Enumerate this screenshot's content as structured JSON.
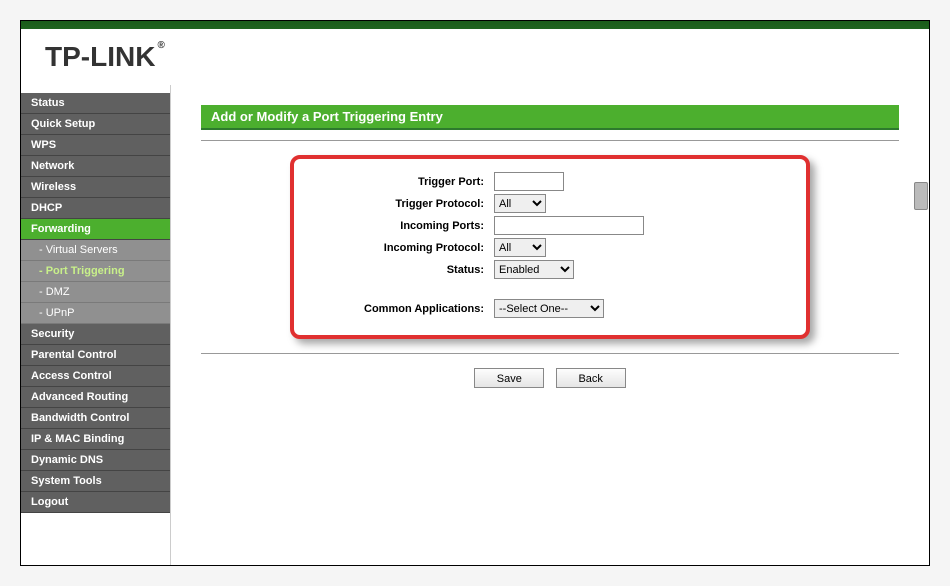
{
  "brand": "TP-LINK",
  "sidebar": {
    "items": [
      {
        "label": "Status",
        "active": false,
        "sub": false
      },
      {
        "label": "Quick Setup",
        "active": false,
        "sub": false
      },
      {
        "label": "WPS",
        "active": false,
        "sub": false
      },
      {
        "label": "Network",
        "active": false,
        "sub": false
      },
      {
        "label": "Wireless",
        "active": false,
        "sub": false
      },
      {
        "label": "DHCP",
        "active": false,
        "sub": false
      },
      {
        "label": "Forwarding",
        "active": true,
        "sub": false
      },
      {
        "label": "- Virtual Servers",
        "active": false,
        "sub": true
      },
      {
        "label": "- Port Triggering",
        "active": true,
        "sub": true
      },
      {
        "label": "- DMZ",
        "active": false,
        "sub": true
      },
      {
        "label": "- UPnP",
        "active": false,
        "sub": true
      },
      {
        "label": "Security",
        "active": false,
        "sub": false
      },
      {
        "label": "Parental Control",
        "active": false,
        "sub": false
      },
      {
        "label": "Access Control",
        "active": false,
        "sub": false
      },
      {
        "label": "Advanced Routing",
        "active": false,
        "sub": false
      },
      {
        "label": "Bandwidth Control",
        "active": false,
        "sub": false
      },
      {
        "label": "IP & MAC Binding",
        "active": false,
        "sub": false
      },
      {
        "label": "Dynamic DNS",
        "active": false,
        "sub": false
      },
      {
        "label": "System Tools",
        "active": false,
        "sub": false
      },
      {
        "label": "Logout",
        "active": false,
        "sub": false
      }
    ]
  },
  "page": {
    "title": "Add or Modify a Port Triggering Entry"
  },
  "form": {
    "trigger_port_label": "Trigger Port:",
    "trigger_port_value": "",
    "trigger_protocol_label": "Trigger Protocol:",
    "trigger_protocol_value": "All",
    "incoming_ports_label": "Incoming Ports:",
    "incoming_ports_value": "",
    "incoming_protocol_label": "Incoming Protocol:",
    "incoming_protocol_value": "All",
    "status_label": "Status:",
    "status_value": "Enabled",
    "common_app_label": "Common Applications:",
    "common_app_value": "--Select One--"
  },
  "buttons": {
    "save": "Save",
    "back": "Back"
  }
}
